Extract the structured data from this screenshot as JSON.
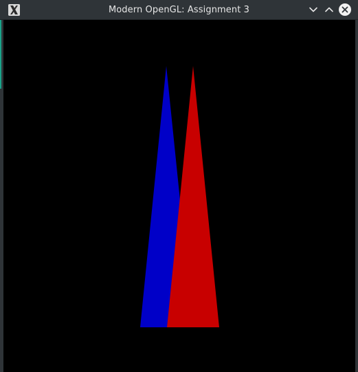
{
  "window": {
    "title": "Modern OpenGL: Assignment 3",
    "controls": {
      "minimize_icon": "chevron-down-icon",
      "maximize_icon": "chevron-up-icon",
      "close_icon": "close-icon"
    },
    "app_icon": "x11-app-icon"
  },
  "scene": {
    "background_color": "#000000",
    "shapes": [
      {
        "name": "blue-triangle",
        "color": "#0000c8"
      },
      {
        "name": "red-triangle",
        "color": "#c80000"
      }
    ]
  }
}
